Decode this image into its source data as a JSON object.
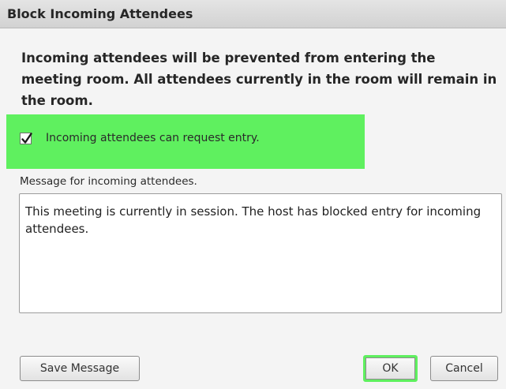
{
  "dialog": {
    "title": "Block Incoming Attendees",
    "intro_text": "Incoming attendees will be prevented from entering the meeting room. All attendees currently in the room will remain in the room.",
    "request_entry": {
      "label": "Incoming attendees can request entry.",
      "checked": true
    },
    "message": {
      "label": "Message for incoming attendees.",
      "value": "This meeting is currently in session. The host has blocked entry for incoming attendees."
    },
    "buttons": {
      "save_message": "Save Message",
      "ok": "OK",
      "cancel": "Cancel"
    },
    "colors": {
      "highlight": "#5ff05f"
    }
  }
}
